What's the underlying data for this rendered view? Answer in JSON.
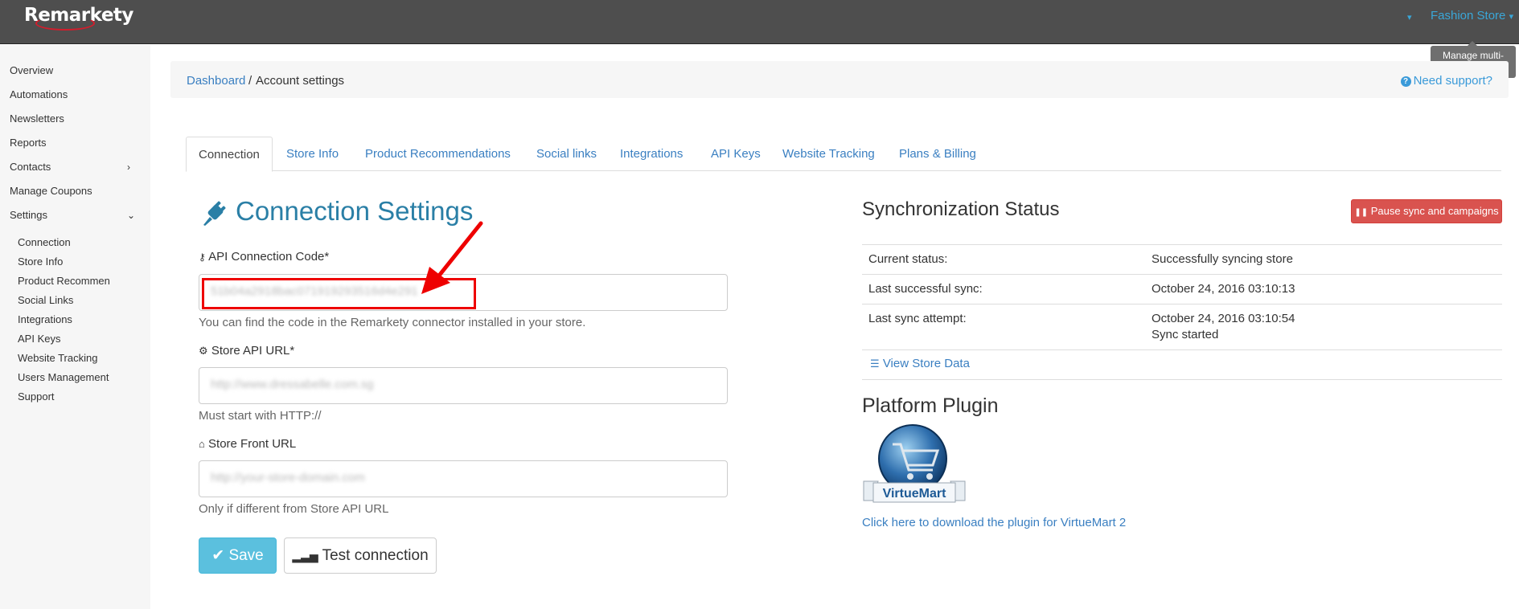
{
  "app": {
    "logo_text": "Remarkety",
    "store_name": "Fashion Store",
    "store_caret": "▾",
    "tooltip": "Manage multi-stores"
  },
  "sidebar": {
    "items": [
      {
        "label": "Overview"
      },
      {
        "label": "Automations"
      },
      {
        "label": "Newsletters"
      },
      {
        "label": "Reports"
      },
      {
        "label": "Contacts"
      },
      {
        "label": "Manage Coupons"
      },
      {
        "label": "Settings"
      }
    ],
    "settings_children": [
      {
        "label": "Connection"
      },
      {
        "label": "Store Info"
      },
      {
        "label": "Product Recommendations"
      },
      {
        "label": "Social Links"
      },
      {
        "label": "Integrations"
      },
      {
        "label": "API Keys"
      },
      {
        "label": "Website Tracking"
      },
      {
        "label": "Users Management"
      },
      {
        "label": "Support"
      }
    ]
  },
  "breadcrumb": {
    "root": "Dashboard",
    "separator": "/",
    "current": "Account settings",
    "support": "Need support?"
  },
  "tabs": [
    {
      "label": "Connection",
      "active": true
    },
    {
      "label": "Store Info"
    },
    {
      "label": "Product Recommendations"
    },
    {
      "label": "Social links"
    },
    {
      "label": "Integrations"
    },
    {
      "label": "API Keys"
    },
    {
      "label": "Website Tracking"
    },
    {
      "label": "Plans & Billing"
    }
  ],
  "connection": {
    "title": "Connection Settings",
    "api_code_label": "API Connection Code*",
    "api_code_value": "51b04a2918bac071919293516d4e291",
    "api_code_help": "You can find the code in the Remarkety connector installed in your store.",
    "store_api_label": "Store API URL*",
    "store_api_value": "http://www.dressabelle.com.sg",
    "store_api_help": "Must start with HTTP://",
    "store_front_label": "Store Front URL",
    "store_front_placeholder": "http://your-store-domain.com",
    "store_front_help": "Only if different from Store API URL",
    "save_label": "Save",
    "test_label": "Test connection"
  },
  "sync": {
    "title": "Synchronization Status",
    "pause_label": "Pause sync and campaigns",
    "rows": [
      {
        "key": "Current status:",
        "value": "Successfully syncing store"
      },
      {
        "key": "Last successful sync:",
        "value": "October 24, 2016 03:10:13"
      },
      {
        "key": "Last sync attempt:",
        "value": "October 24, 2016 03:10:54",
        "value2": "Sync started"
      }
    ],
    "view_data": "View Store Data"
  },
  "plugin": {
    "title": "Platform Plugin",
    "logo_text": "VirtueMart",
    "download_link": "Click here to download the plugin for VirtueMart 2"
  },
  "colors": {
    "topbar": "#4e4e4e",
    "link": "#3a7fc1",
    "title": "#2a7fa6",
    "save": "#5bc0de",
    "pause": "#d9534f",
    "highlight": "#ee0000"
  }
}
